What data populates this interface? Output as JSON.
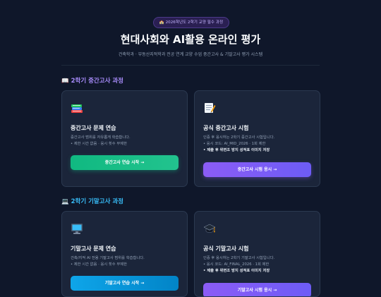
{
  "header": {
    "badge": "🏫 2026학년도 2학기 교양 필수 과정",
    "title": "현대사회와 AI활용 온라인 평가",
    "subtitle": "건축학과 · 부동산지적학과 전공 연계 교양 수업 중간고사 & 기말고사 평가 시스템"
  },
  "sections": [
    {
      "icon": "📖",
      "title": "2학기 중간고사 과정",
      "cards": [
        {
          "icon": "books-icon",
          "title": "중간고사 문제 연습",
          "lines": [
            "중간고사 범위를 자유롭게 학습합니다.",
            "• 제한 시간 없음 · 응시 횟수 무제한"
          ],
          "button": "중간고사 연습 시작 →"
        },
        {
          "icon": "memo-icon",
          "title": "공식 중간고사 시험",
          "lines": [
            "인증 후 응시하는 2학기 중간고사 시험입니다.",
            "• 응시 코드: AI_MID_2026 · 1회 제한",
            "• 제출 후 위변조 방지 성적표 이미지 저장"
          ],
          "button": "중간고사 시험 응시 →"
        }
      ]
    },
    {
      "icon": "💻",
      "title": "2학기 기말고사 과정",
      "cards": [
        {
          "icon": "monitor-icon",
          "title": "기말고사 문제 연습",
          "lines": [
            "건축/지적 AI 전용 기말고사 범위를 학습합니다.",
            "• 제한 시간 없음 · 응시 횟수 무제한"
          ],
          "button": "기말고사 연습 시작 →"
        },
        {
          "icon": "graduation-cap-icon",
          "title": "공식 기말고사 시험",
          "lines": [
            "인증 후 응시하는 2학기 기말고사 시험입니다.",
            "• 응시 코드: AI_FINAL_2026 · 1회 제한",
            "• 제출 후 위변조 방지 성적표 이미지 저장"
          ],
          "button": "기말고사 시험 응시 →"
        }
      ]
    }
  ]
}
